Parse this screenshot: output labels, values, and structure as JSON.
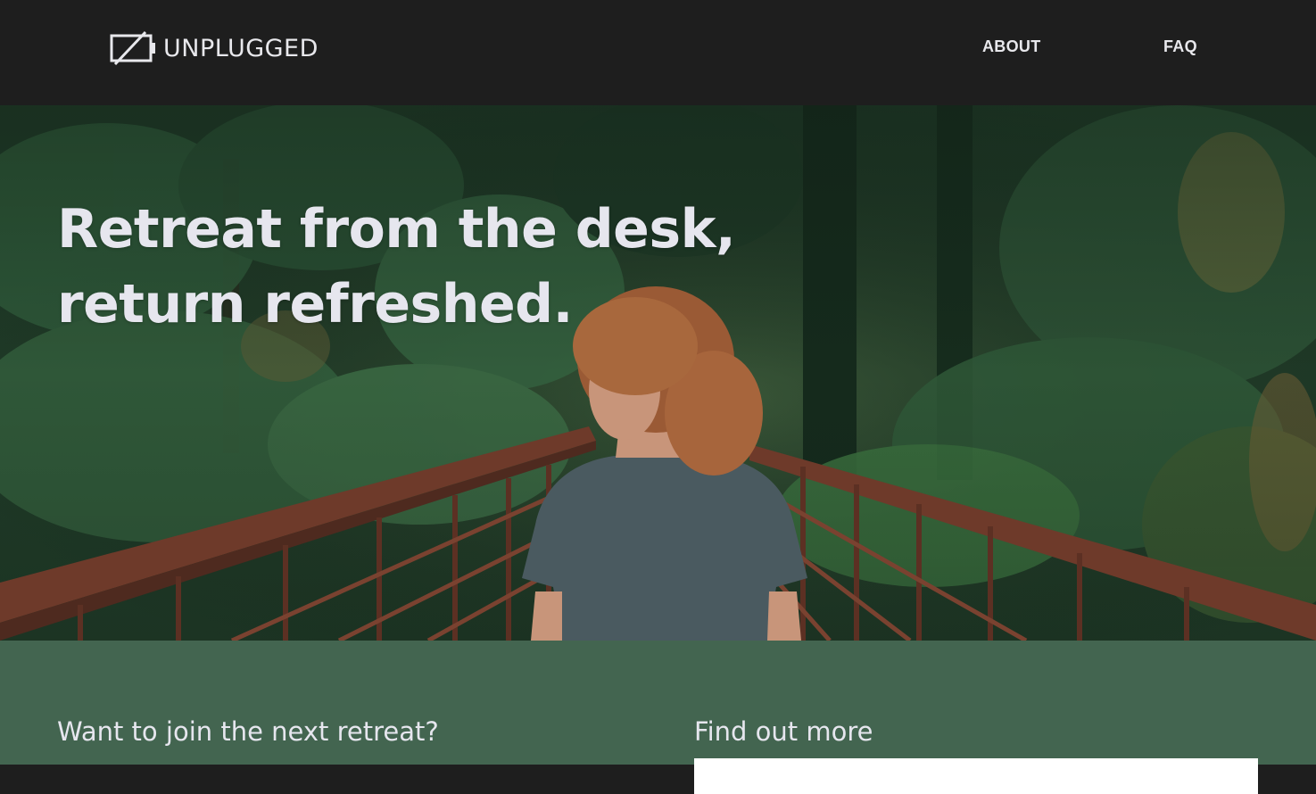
{
  "header": {
    "logo_text": "UNPLUGGED",
    "nav": [
      {
        "label": "ABOUT"
      },
      {
        "label": "FAQ"
      }
    ]
  },
  "hero": {
    "headline_line1": "Retreat from the desk,",
    "headline_line2": "return refreshed."
  },
  "cta": {
    "left_title": "Want to join the next retreat?",
    "right_title": "Find out more"
  },
  "colors": {
    "header_bg": "#1e1e1e",
    "text_light": "#e6e6ee",
    "section_green": "#436550",
    "railing": "#6e3a2a",
    "shirt": "#4a5a60",
    "hair": "#9a5a35"
  }
}
